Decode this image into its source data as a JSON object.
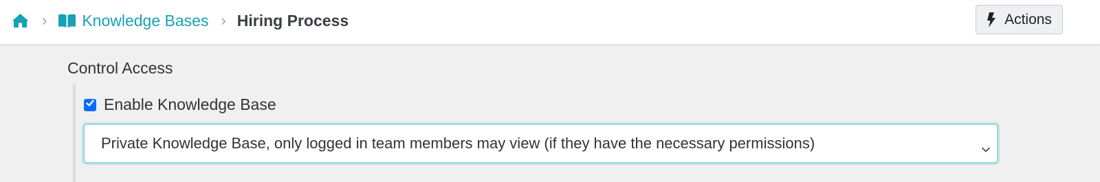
{
  "breadcrumb": {
    "home_icon": "home-icon",
    "knowledge_bases_icon": "open-book-icon",
    "knowledge_bases_label": "Knowledge Bases",
    "current": "Hiring Process"
  },
  "header": {
    "actions_label": "Actions",
    "actions_icon": "bolt-icon"
  },
  "control_access": {
    "title": "Control Access",
    "enable_label": "Enable Knowledge Base",
    "enable_checked": true,
    "visibility_selected": "Private Knowledge Base, only logged in team members may view (if they have the necessary permissions)"
  },
  "colors": {
    "accent": "#17a2b8",
    "checkbox": "#0a6cff",
    "page_background": "#f0f0f0"
  }
}
